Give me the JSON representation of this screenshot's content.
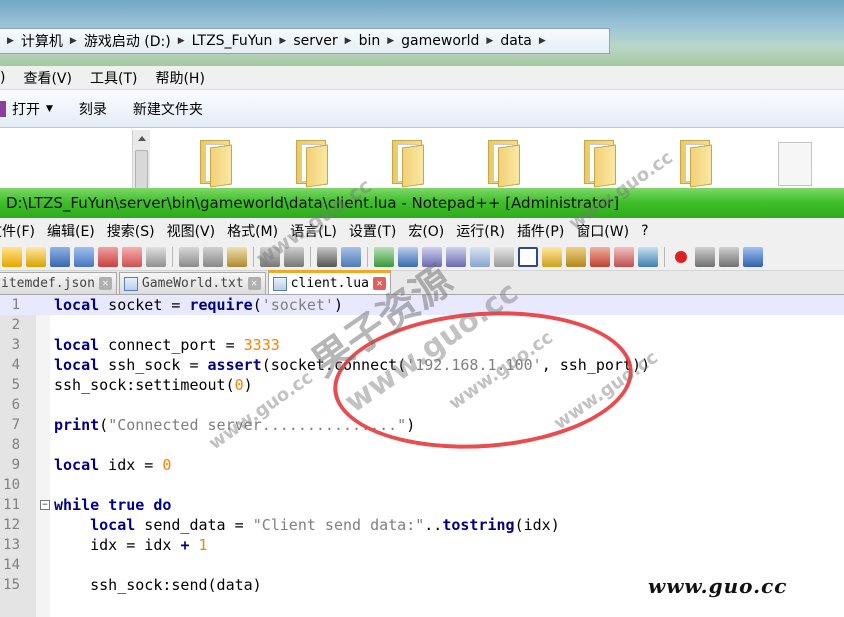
{
  "explorer": {
    "breadcrumb": [
      "计算机",
      "游戏启动 (D:)",
      "LTZS_FuYun",
      "server",
      "bin",
      "gameworld",
      "data"
    ],
    "menu": [
      ")",
      "查看(V)",
      "工具(T)",
      "帮助(H)"
    ],
    "commands": [
      "打开",
      "刻录",
      "新建文件夹"
    ]
  },
  "notepad": {
    "title": "D:\\LTZS_FuYun\\server\\bin\\gameworld\\data\\client.lua - Notepad++ [Administrator]",
    "menu": [
      "文件(F)",
      "编辑(E)",
      "搜索(S)",
      "视图(V)",
      "格式(M)",
      "语言(L)",
      "设置(T)",
      "宏(O)",
      "运行(R)",
      "插件(P)",
      "窗口(W)",
      "?"
    ],
    "tabs": [
      {
        "label": "itemdef.json"
      },
      {
        "label": "GameWorld.txt"
      },
      {
        "label": "client.lua"
      }
    ],
    "lines": [
      {
        "n": "1",
        "html": "<span class=\"kw\">local</span> socket = <span class=\"fn\">require</span>(<span class=\"str\">'socket'</span>)"
      },
      {
        "n": "2",
        "html": ""
      },
      {
        "n": "3",
        "html": "<span class=\"kw\">local</span> connect_port = <span class=\"num\">3333</span>"
      },
      {
        "n": "4",
        "html": "<span class=\"kw\">local</span> ssh_sock = <span class=\"fn\">assert</span>(socket.connect(<span class=\"str\">'192.168.1.100'</span>, ssh_port))"
      },
      {
        "n": "5",
        "html": "ssh_sock:settimeout(<span class=\"num\">0</span>)"
      },
      {
        "n": "6",
        "html": ""
      },
      {
        "n": "7",
        "html": "<span class=\"fn\">print</span>(<span class=\"str\">\"Connected server...............\"</span>)"
      },
      {
        "n": "8",
        "html": ""
      },
      {
        "n": "9",
        "html": "<span class=\"kw\">local</span> idx = <span class=\"num\">0</span>"
      },
      {
        "n": "10",
        "html": ""
      },
      {
        "n": "11",
        "html": "<span class=\"kw\">while</span> <span class=\"kw\">true</span> <span class=\"kw\">do</span>"
      },
      {
        "n": "12",
        "html": "    <span class=\"kw\">local</span> send_data = <span class=\"str\">\"Client send data:\"</span>..<span class=\"fn\">tostring</span>(idx)"
      },
      {
        "n": "13",
        "html": "    idx = idx <span class=\"op\">+</span> <span class=\"num\">1</span>"
      },
      {
        "n": "14",
        "html": ""
      },
      {
        "n": "15",
        "html": "    ssh_sock:send(data)"
      }
    ]
  },
  "watermark": {
    "domain": "www.guo.cc",
    "brand": "果子资源"
  }
}
